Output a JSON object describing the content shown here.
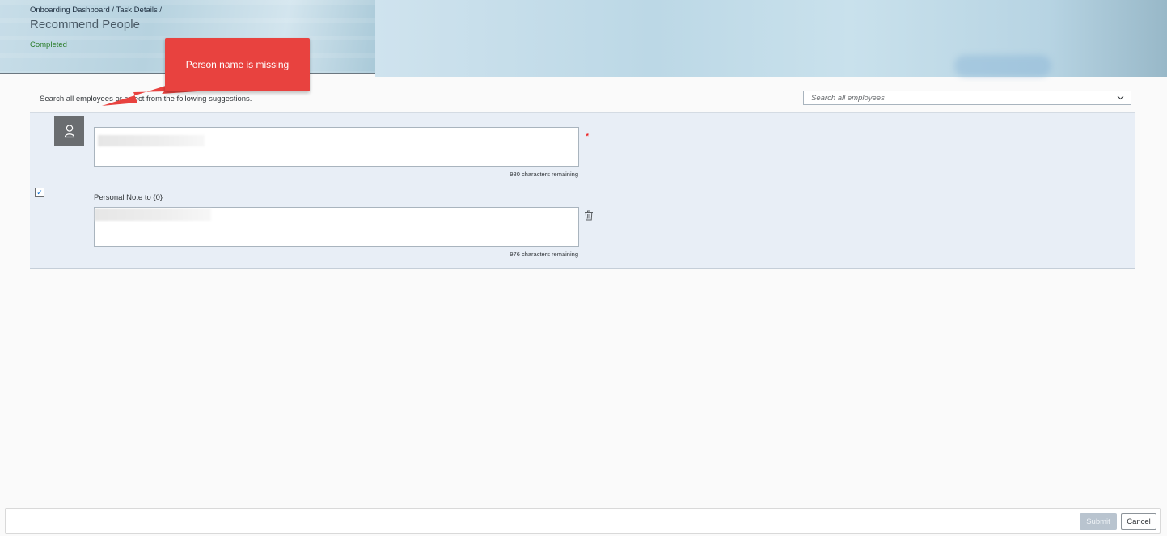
{
  "header": {
    "breadcrumb": "Onboarding Dashboard / Task Details /",
    "title": "Recommend People",
    "status": "Completed"
  },
  "search": {
    "instruction": "Search all employees or select from the following suggestions.",
    "placeholder": "Search all employees",
    "chevron_icon": "chevron-down-icon"
  },
  "recommendation": {
    "avatar_icon": "person-icon",
    "name_counter": "980 characters remaining",
    "required_marker": "*",
    "checked": true,
    "note_label": "Personal Note to {0}",
    "note_counter": "976 characters remaining",
    "delete_icon": "trash-icon"
  },
  "footer": {
    "submit_label": "Submit",
    "cancel_label": "Cancel"
  },
  "annotation": {
    "text": "Person name is missing",
    "color": "#e8423f"
  },
  "colors": {
    "panel_bg": "#e8eef6",
    "status_green": "#2b7d2b",
    "avatar_bg": "#6a6d70"
  }
}
